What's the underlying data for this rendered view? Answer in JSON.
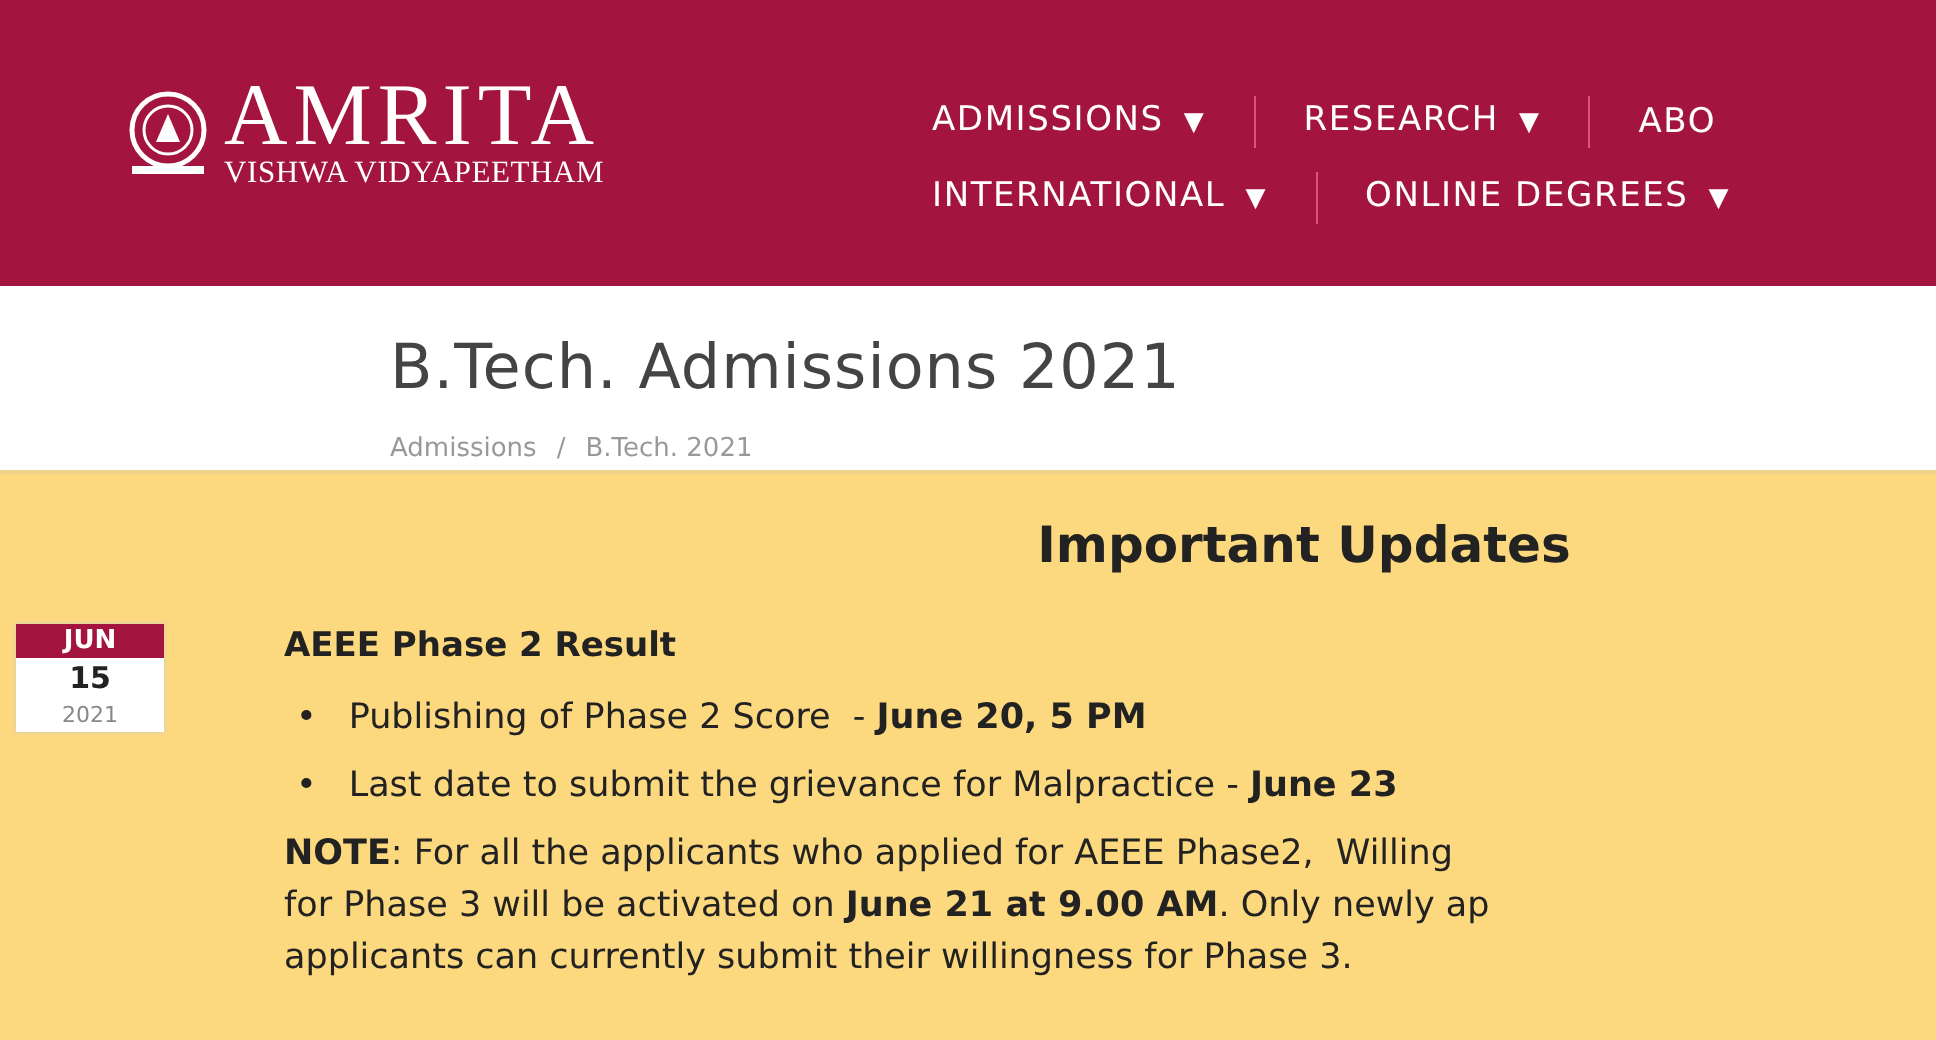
{
  "header": {
    "logo": {
      "name": "AMRITA",
      "subtitle": "VISHWA VIDYAPEETHAM"
    },
    "nav_rows": [
      [
        {
          "label": "ADMISSIONS",
          "caret": "▼"
        },
        {
          "label": "RESEARCH",
          "caret": "▼"
        },
        {
          "label": "ABO"
        }
      ],
      [
        {
          "label": "INTERNATIONAL",
          "caret": "▼"
        },
        {
          "label": "ONLINE DEGREES",
          "caret": "▼"
        }
      ]
    ]
  },
  "page_title": "B.Tech. Admissions 2021",
  "breadcrumb": [
    "Admissions",
    "B.Tech. 2021"
  ],
  "breadcrumb_separator": "/",
  "updates": {
    "heading": "Important Updates",
    "date": {
      "month": "JUN",
      "day": "15",
      "year": "2021"
    },
    "title": "AEEE Phase 2 Result",
    "bullet_marker": "•",
    "bullets": [
      "Publishing of Phase 2 Score  - **June 20, 5 PM**",
      "Last date to submit the grievance for Malpractice - **June 23**"
    ],
    "note_lines": [
      "**NOTE**: For all the applicants who applied for AEEE Phase2,  Willing",
      "for Phase 3 will be activated on **June 21 at 9.00 AM**. Only newly ap",
      "applicants can currently submit their willingness for Phase 3."
    ]
  }
}
